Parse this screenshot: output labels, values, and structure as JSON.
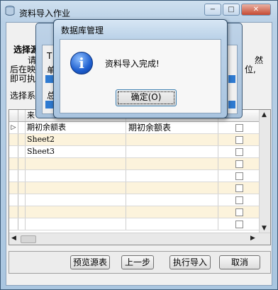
{
  "main_window": {
    "title": "资料导入作业",
    "minimize": "−",
    "maximize": "□",
    "close": "✕"
  },
  "background_text": {
    "select_source": "选择源",
    "line1_start": "请",
    "line1_end": "然",
    "line2_start": "后在映",
    "line2_end": "位,",
    "line3": "即可执",
    "select_sheet": "选择系"
  },
  "progress_dialog": {
    "label1": "单",
    "label2": "总",
    "t_label": "T"
  },
  "grid": {
    "header": [
      "来",
      "",
      ""
    ],
    "rows": [
      {
        "indicator": "▷",
        "sheet": "期初余额表",
        "mapped": "期初余额表"
      },
      {
        "indicator": "",
        "sheet": "Sheet2",
        "mapped": ""
      },
      {
        "indicator": "",
        "sheet": "Sheet3",
        "mapped": ""
      },
      {
        "indicator": "",
        "sheet": "",
        "mapped": ""
      },
      {
        "indicator": "",
        "sheet": "",
        "mapped": ""
      },
      {
        "indicator": "",
        "sheet": "",
        "mapped": ""
      },
      {
        "indicator": "",
        "sheet": "",
        "mapped": ""
      },
      {
        "indicator": "",
        "sheet": "",
        "mapped": ""
      },
      {
        "indicator": "",
        "sheet": "",
        "mapped": ""
      }
    ]
  },
  "buttons": {
    "preview": "预览源表",
    "prev": "上一步",
    "execute": "执行导入",
    "cancel": "取消"
  },
  "msgbox": {
    "title": "数据库管理",
    "message": "资料导入完成!",
    "ok": "确定(O)",
    "icon": "info-icon"
  }
}
